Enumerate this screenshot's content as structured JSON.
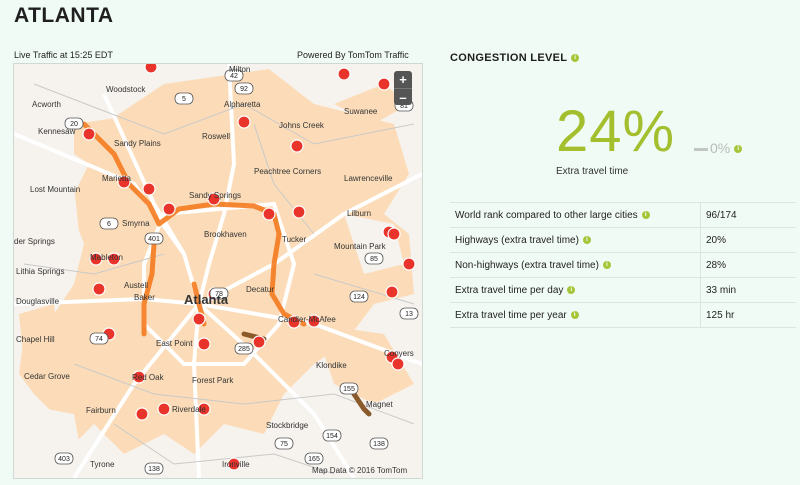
{
  "header": {
    "city": "ATLANTA"
  },
  "map": {
    "live_label": "Live Traffic at 15:25 EDT",
    "powered_label": "Powered By TomTom Traffic",
    "attribution": "Map Data © 2016 TomTom",
    "zoom_in": "+",
    "zoom_out": "–",
    "place_labels": [
      {
        "text": "Milton"
      },
      {
        "text": "Woodstock"
      },
      {
        "text": "Alpharetta"
      },
      {
        "text": "Acworth"
      },
      {
        "text": "Suwanee"
      },
      {
        "text": "Kennesaw"
      },
      {
        "text": "Roswell"
      },
      {
        "text": "Johns Creek"
      },
      {
        "text": "Sandy Plains"
      },
      {
        "text": "Lost Mountain"
      },
      {
        "text": "Marietta"
      },
      {
        "text": "Peachtree Corners"
      },
      {
        "text": "Lawrenceville"
      },
      {
        "text": "Sandy Springs"
      },
      {
        "text": "Smyrna"
      },
      {
        "text": "Brookhaven"
      },
      {
        "text": "Lilburn"
      },
      {
        "text": "Tucker"
      },
      {
        "text": "Mableton"
      },
      {
        "text": "Mountain Park"
      },
      {
        "text": "Lithia Springs"
      },
      {
        "text": "Decatur"
      },
      {
        "text": "Atlanta"
      },
      {
        "text": "Candler-McAfee"
      },
      {
        "text": "Chapel Hill"
      },
      {
        "text": "East Point"
      },
      {
        "text": "Conyers"
      },
      {
        "text": "Cedar Grove"
      },
      {
        "text": "Red Oak"
      },
      {
        "text": "Klondike"
      },
      {
        "text": "Forest Park"
      },
      {
        "text": "Magnet"
      },
      {
        "text": "Fairburn"
      },
      {
        "text": "Riverdale"
      },
      {
        "text": "Stockbridge"
      },
      {
        "text": "Tyrone"
      },
      {
        "text": "Ironville"
      },
      {
        "text": "Austell"
      },
      {
        "text": "Baker"
      },
      {
        "text": "Douglasville"
      },
      {
        "text": "der Springs"
      }
    ],
    "shields": [
      "92",
      "20",
      "5",
      "401",
      "285",
      "85",
      "75",
      "78",
      "124",
      "138",
      "155",
      "154",
      "165",
      "403",
      "138",
      "81",
      "42",
      "6",
      "74",
      "13"
    ]
  },
  "congestion": {
    "heading": "CONGESTION LEVEL",
    "percent": "24%",
    "delta": "0%",
    "label": "Extra travel time"
  },
  "stats": [
    {
      "label": "World rank compared to other large cities",
      "value": "96/174"
    },
    {
      "label": "Highways (extra travel time)",
      "value": "20%"
    },
    {
      "label": "Non-highways (extra travel time)",
      "value": "28%"
    },
    {
      "label": "Extra travel time per day",
      "value": "33 min"
    },
    {
      "label": "Extra travel time per year",
      "value": "125 hr"
    }
  ],
  "colors": {
    "accent_green": "#a3bf2e",
    "urban_orange": "#fcd9b2",
    "traffic_orange": "#f47b20",
    "incident_red": "#e8342a"
  },
  "icons": [
    "info-icon",
    "incident-icon",
    "zoom-in-icon",
    "zoom-out-icon"
  ]
}
